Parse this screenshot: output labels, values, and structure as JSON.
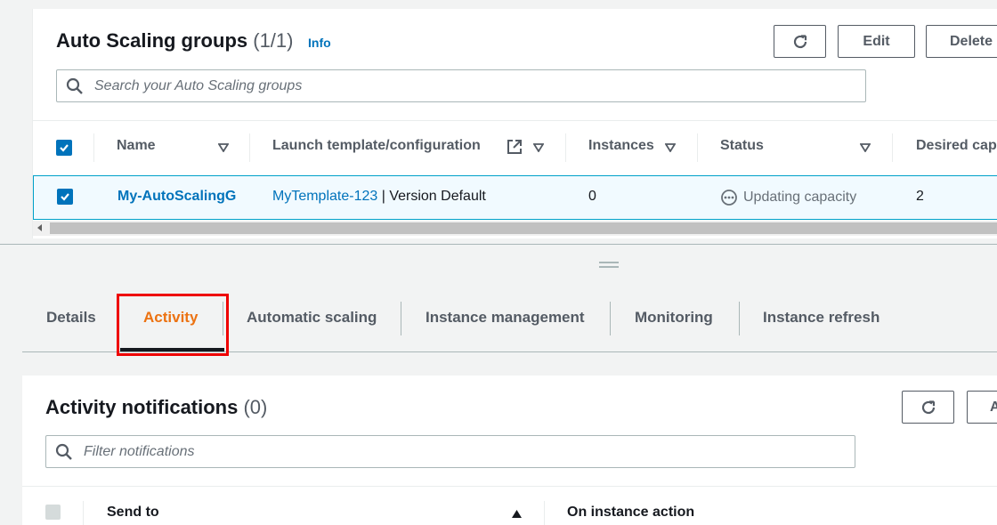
{
  "asg": {
    "title": "Auto Scaling groups",
    "count": "(1/1)",
    "info": "Info",
    "buttons": {
      "edit": "Edit",
      "delete": "Delete"
    },
    "search": {
      "placeholder": "Search your Auto Scaling groups"
    },
    "columns": [
      "Name",
      "Launch template/configuration",
      "Instances",
      "Status",
      "Desired cap"
    ],
    "row": {
      "name": "My-AutoScalingG",
      "template": "MyTemplate-123",
      "version": " | Version Default",
      "instances": "0",
      "status": "Updating capacity",
      "desired": "2"
    }
  },
  "tabs": [
    "Details",
    "Activity",
    "Automatic scaling",
    "Instance management",
    "Monitoring",
    "Instance refresh"
  ],
  "active_tab": "Activity",
  "notifications": {
    "title": "Activity notifications",
    "count": "(0)",
    "button_partial": "A",
    "search": {
      "placeholder": "Filter notifications"
    },
    "columns": [
      "Send to",
      "On instance action"
    ]
  },
  "colors": {
    "link": "#0073bb",
    "active_tab": "#ec7211",
    "highlight": "#ee0000",
    "selected_row": "#f1faff"
  }
}
